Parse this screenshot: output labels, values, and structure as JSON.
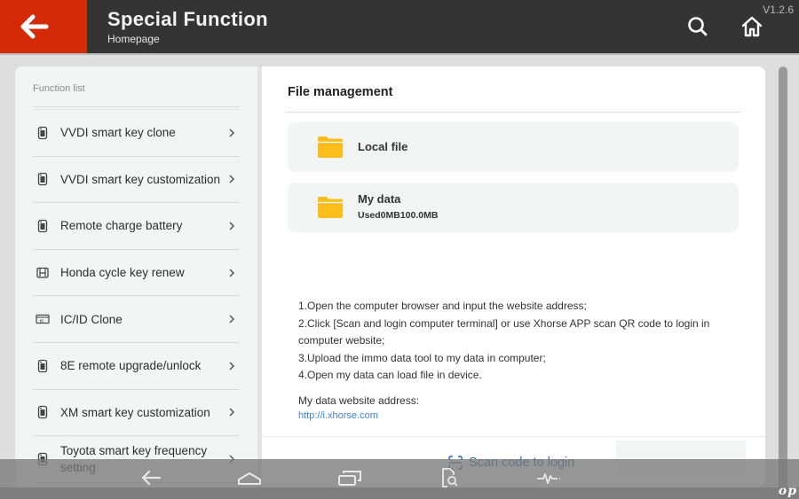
{
  "header": {
    "title": "Special Function",
    "subtitle": "Homepage",
    "version": "V1.2.6",
    "back_icon": "arrow-left-icon",
    "search_icon": "search-icon",
    "home_icon": "home-icon",
    "accent_color": "#d42a08"
  },
  "sidebar": {
    "heading": "Function list",
    "items": [
      {
        "label": "VVDI smart key clone",
        "icon": "smart-key-icon"
      },
      {
        "label": "VVDI smart key customization",
        "icon": "smart-key-icon"
      },
      {
        "label": "Remote charge battery",
        "icon": "smart-key-icon"
      },
      {
        "label": "Honda cycle key renew",
        "icon": "honda-key-icon"
      },
      {
        "label": "IC/ID Clone",
        "icon": "ic-card-icon"
      },
      {
        "label": "8E remote upgrade/unlock",
        "icon": "smart-key-icon"
      },
      {
        "label": "XM smart key customization",
        "icon": "smart-key-icon"
      },
      {
        "label": "Toyota smart key frequency setting",
        "icon": "smart-key-icon"
      }
    ]
  },
  "main": {
    "section_title": "File management",
    "files": {
      "local": {
        "title": "Local file",
        "icon": "folder-icon"
      },
      "mydata": {
        "title": "My data",
        "usage": "Used0MB100.0MB",
        "icon": "folder-icon"
      }
    },
    "instructions": [
      "1.Open the computer browser and input the website address;",
      "2.Click [Scan and login computer terminal] or use Xhorse APP scan QR code to login in computer website;",
      "3.Upload the immo data tool to my data in computer;",
      "4.Open my data can load file in device."
    ],
    "address_label": "My data website address:",
    "address_link": "http://i.xhorse.com",
    "scan_button": "Scan code to login",
    "folder_color": "#fbbd1c",
    "link_color": "#3a86d9"
  },
  "navbar": {
    "buttons": [
      "back-icon",
      "home-icon",
      "recent-apps-icon",
      "screenshot-search-icon",
      "diagnostic-pulse-icon"
    ],
    "watermark": "op"
  }
}
